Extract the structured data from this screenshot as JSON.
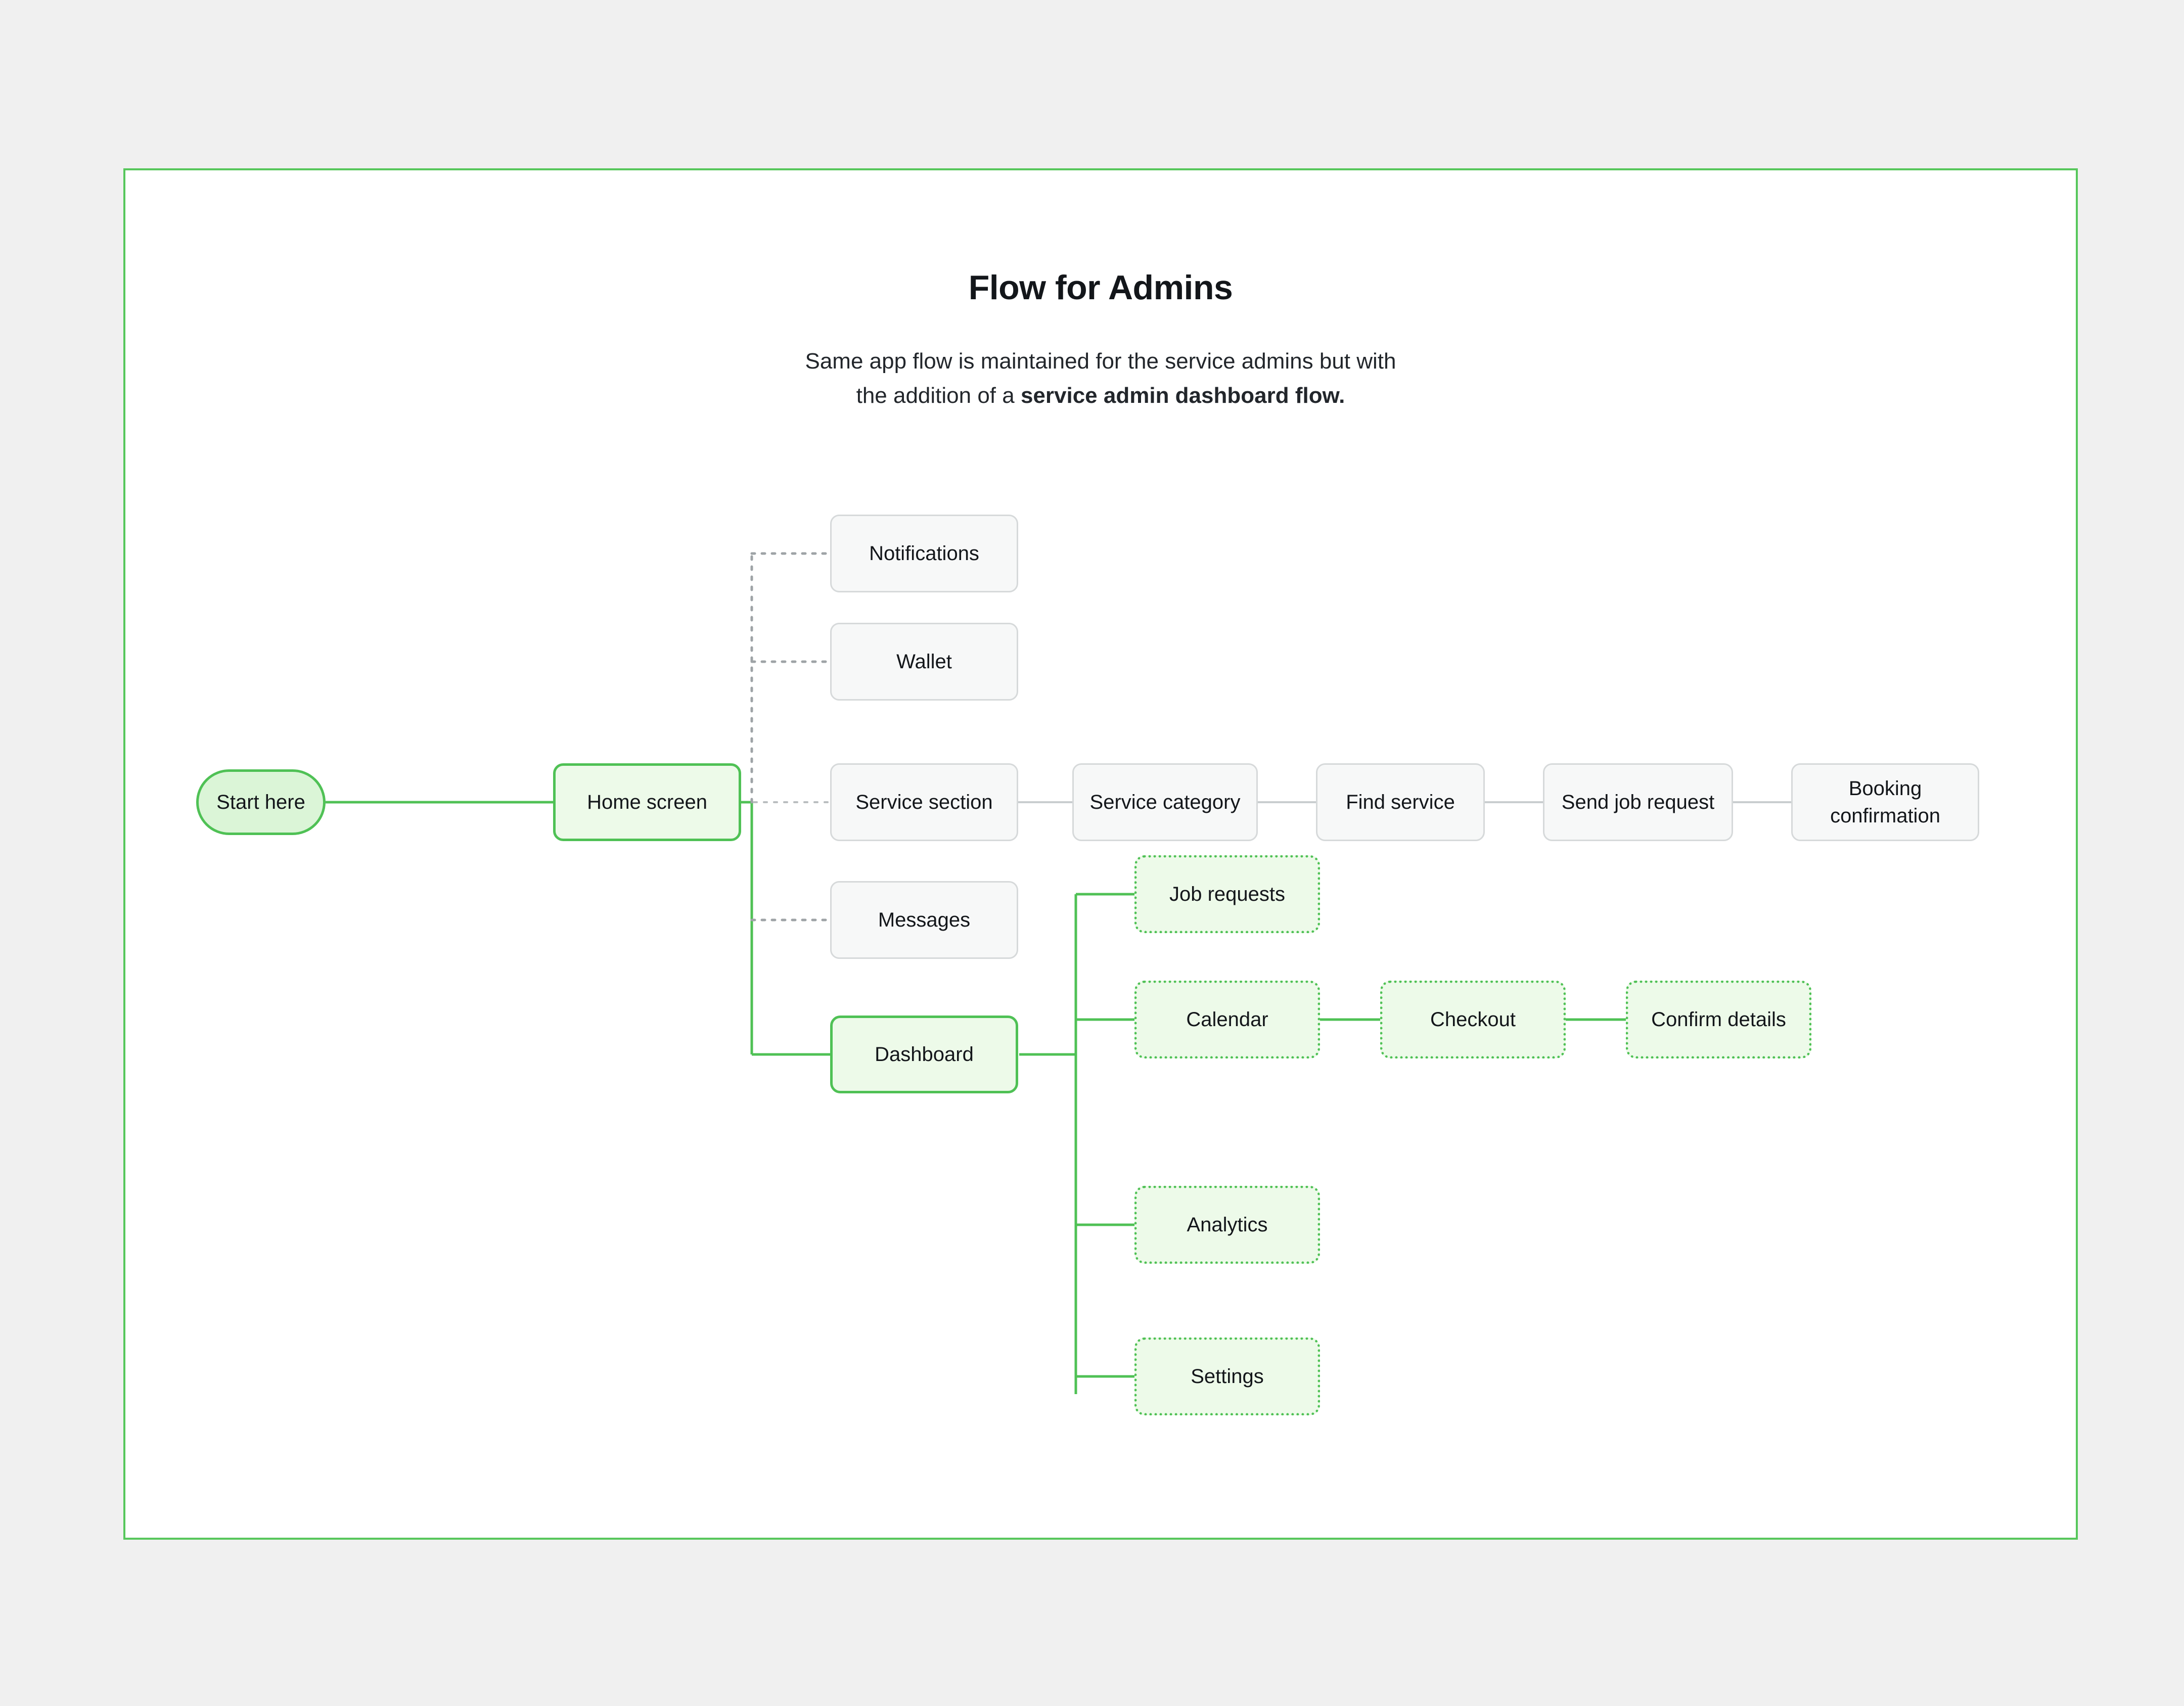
{
  "theme": {
    "page_background": "#f0f0f0",
    "canvas_background": "#ffffff",
    "canvas_border": "#57c75c",
    "accent_green": "#4fc155",
    "green_fill": "#edfae9",
    "pill_fill": "#dbf5d7",
    "gray_fill": "#f7f8f8",
    "gray_border": "#d6d9da",
    "text_color": "#13161a"
  },
  "header": {
    "title": "Flow for Admins",
    "subtitle_line1": "Same app flow is maintained for the service admins but with",
    "subtitle_line2_prefix": "the addition of a ",
    "subtitle_line2_bold": "service admin dashboard flow."
  },
  "flow": {
    "start": {
      "label": "Start here"
    },
    "home": {
      "label": "Home screen"
    },
    "home_children": [
      {
        "label": "Notifications",
        "style": "gray"
      },
      {
        "label": "Wallet",
        "style": "gray"
      },
      {
        "label": "Service section",
        "style": "gray"
      },
      {
        "label": "Messages",
        "style": "gray"
      },
      {
        "label": "Dashboard",
        "style": "green-solid"
      }
    ],
    "service_chain": [
      {
        "label": "Service category"
      },
      {
        "label": "Find service"
      },
      {
        "label": "Send job request"
      },
      {
        "label": "Booking confirmation",
        "line1": "Booking",
        "line2": "confirmation"
      }
    ],
    "dashboard_children": [
      {
        "label": "Job requests"
      },
      {
        "label": "Calendar"
      },
      {
        "label": "Analytics"
      },
      {
        "label": "Settings"
      }
    ],
    "calendar_chain": [
      {
        "label": "Checkout"
      },
      {
        "label": "Confirm details"
      }
    ]
  }
}
